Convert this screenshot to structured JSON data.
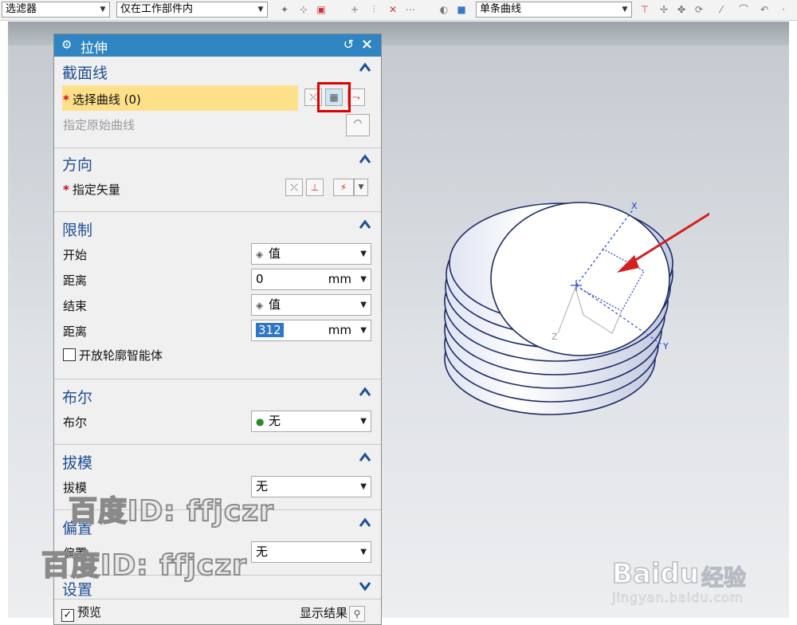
{
  "toolbar": {
    "filter_combo": "选滤器",
    "scope_combo": "仅在工作部件内",
    "curve_rule_combo": "单条曲线"
  },
  "dialog": {
    "title": "拉伸",
    "sections": {
      "section_curve": {
        "title": "截面线",
        "select_curve": "选择曲线 (0)",
        "specify_original": "指定原始曲线"
      },
      "direction": {
        "title": "方向",
        "specify_vector": "指定矢量"
      },
      "limits": {
        "title": "限制",
        "start_label": "开始",
        "start_value": "值",
        "start_distance_label": "距离",
        "start_distance": "0",
        "end_label": "结束",
        "end_value": "值",
        "end_distance_label": "距离",
        "end_distance": "312",
        "unit": "mm",
        "open_profile": "开放轮廓智能体"
      },
      "boolean": {
        "title": "布尔",
        "label": "布尔",
        "value": "无"
      },
      "draft": {
        "title": "拔模",
        "label": "拔模",
        "value": "无"
      },
      "offset": {
        "title": "偏置",
        "label": "偏置",
        "value": "无"
      },
      "settings": {
        "title": "设置"
      },
      "preview": {
        "label": "预览",
        "show_result": "显示结果"
      }
    }
  },
  "model": {
    "axis_x": "X",
    "axis_y": "Y",
    "axis_z": "Z"
  },
  "watermark": {
    "text": "百度ID: ffjczr",
    "baidu_logo": "Baidu",
    "baidu_cn": "经验",
    "baidu_url": "jingyan.baidu.com"
  },
  "colors": {
    "title_bar": "#2f85c2",
    "section_title": "#1f4e94",
    "highlight_row": "#ffe08a",
    "required_star": "#d9001b",
    "callout_box": "#e00000",
    "arrow": "#d42020",
    "model_face": "#ffffff",
    "model_edge": "#1c2b66"
  }
}
